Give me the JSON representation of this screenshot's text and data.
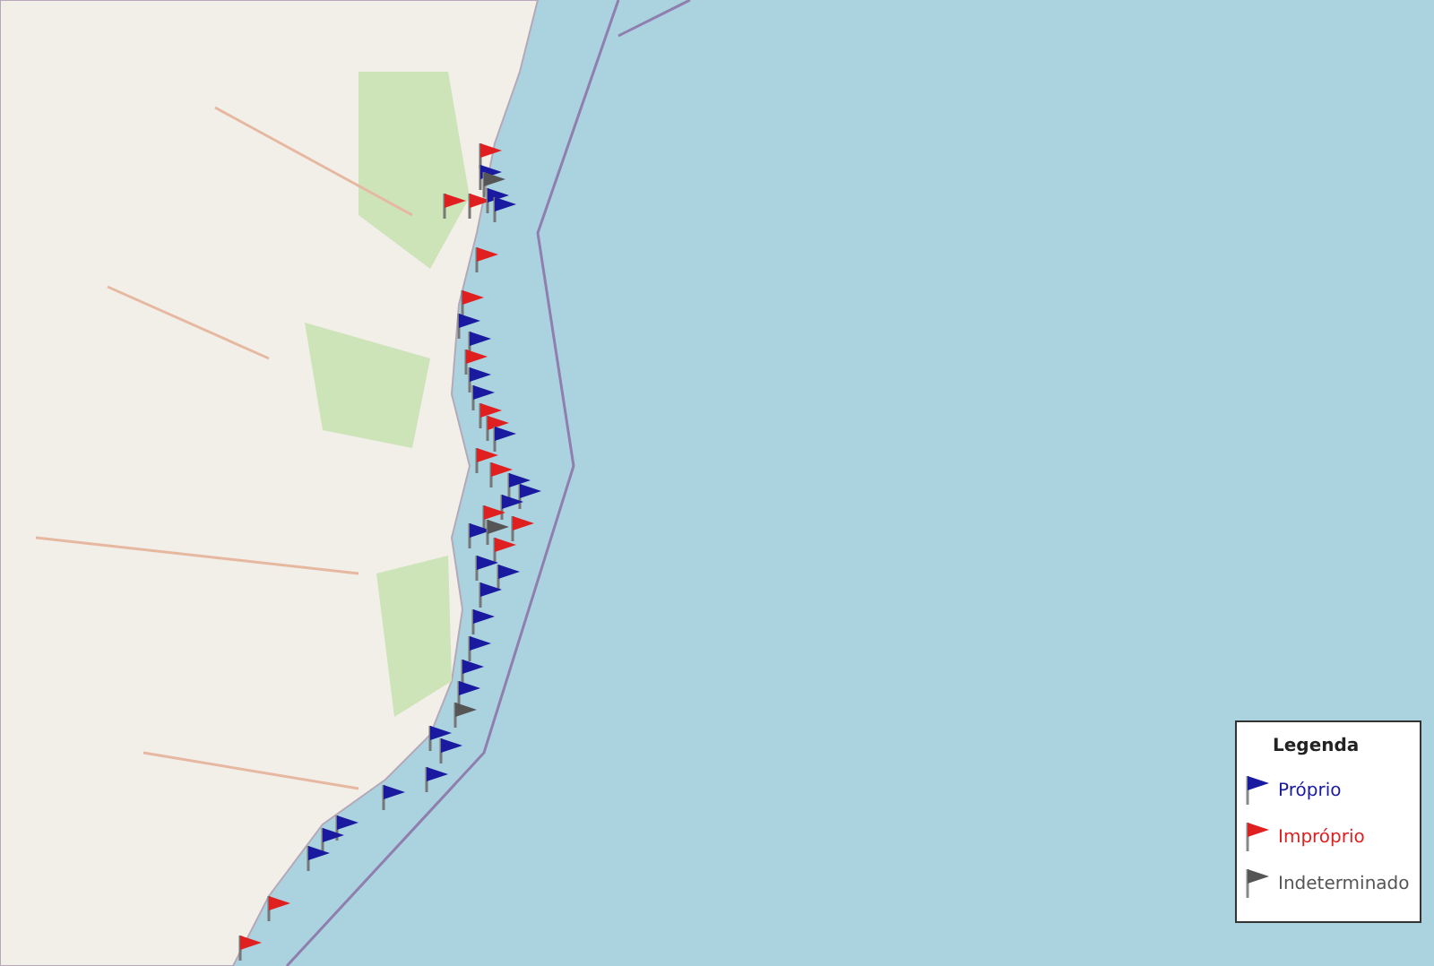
{
  "legend": {
    "title": "Legenda",
    "items": [
      {
        "label": "Próprio",
        "color": "#1a1aa0"
      },
      {
        "label": "Impróprio",
        "color": "#e02020"
      },
      {
        "label": "Indeterminado",
        "color": "#555555"
      }
    ]
  }
}
